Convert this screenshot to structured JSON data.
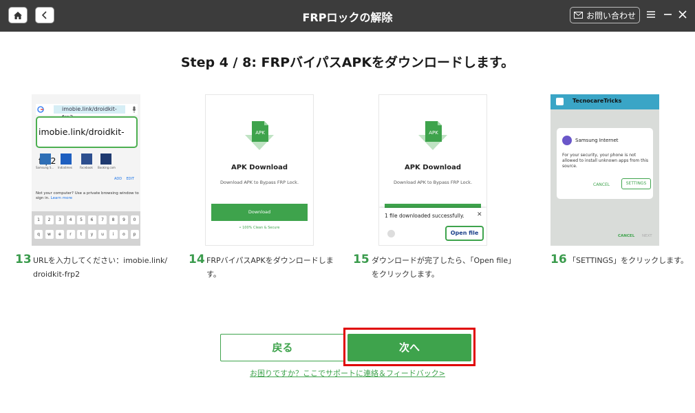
{
  "app": {
    "title": "FRPロックの解除",
    "contact_label": "お問い合わせ",
    "icons": {
      "home": "home-icon",
      "back": "chevron-left-icon",
      "mail": "mail-icon",
      "menu": "hamburger-icon",
      "minimize": "minimize-icon",
      "close": "close-icon"
    }
  },
  "step_title": "Step 4 / 8: FRPバイパスAPKをダウンロードします。",
  "steps": [
    {
      "num": "13",
      "desc_line1": "URLを入力してください：imobie.link/",
      "desc_line2": "droidkit-frp2",
      "shot": {
        "url_small": "imobie.link/droidkit-frp2",
        "url_big": "imobie.link/droidkit-frp2",
        "apps": [
          "Samsung S...",
          "Indiatimes",
          "Facebook",
          "Booking.com"
        ],
        "add": "ADD",
        "edit": "EDIT",
        "note": "Not your computer? Use a private browsing window to sign in.",
        "learn_more": "Learn more",
        "keys_row1": [
          "1",
          "2",
          "3",
          "4",
          "5",
          "6",
          "7",
          "8",
          "9",
          "0"
        ],
        "keys_row2": [
          "q",
          "w",
          "e",
          "r",
          "t",
          "y",
          "u",
          "i",
          "o",
          "p"
        ]
      }
    },
    {
      "num": "14",
      "desc_line1": "FRPバイパスAPKをダウンロードします。",
      "shot": {
        "icon_label": "APK",
        "title": "APK Download",
        "sub": "Download APK to Bypass FRP Lock.",
        "button": "Download",
        "secure": "• 100% Clean & Secure"
      }
    },
    {
      "num": "15",
      "desc_line1": "ダウンロードが完了したら、「Open file」",
      "desc_line2": "をクリックします。",
      "shot": {
        "icon_label": "APK",
        "title": "APK Download",
        "sub": "Download APK to Bypass FRP Lock.",
        "toast": "1 file downloaded successfully.",
        "open_file": "Open file"
      }
    },
    {
      "num": "16",
      "desc_line1": "「SETTINGS」をクリックします。",
      "shot": {
        "site": "TecnocareTricks",
        "dialog_title": "Samsung Internet",
        "dialog_msg": "For your security, your phone is not allowed to install unknown apps from this source.",
        "cancel": "CANCEL",
        "settings": "SETTINGS",
        "bottom_cancel": "CANCEL",
        "bottom_next": "NEXT"
      }
    }
  ],
  "buttons": {
    "back": "戻る",
    "next": "次へ"
  },
  "help_link": "お困りですか？ここでサポートに連絡＆フィードバック>",
  "colors": {
    "accent": "#3ea34c",
    "titlebar": "#3c3c3c",
    "highlight": "#e00000"
  }
}
